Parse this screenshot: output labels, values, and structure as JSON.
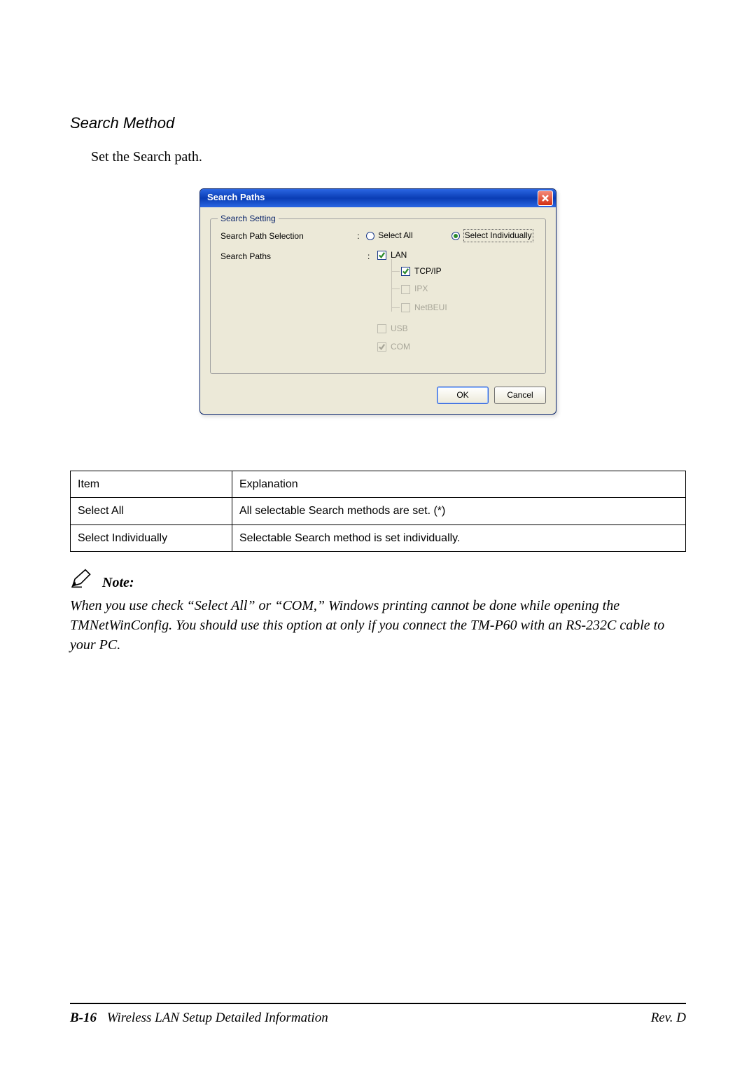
{
  "heading": "Search Method",
  "body_text": "Set the Search path.",
  "dialog": {
    "title": "Search Paths",
    "group_legend": "Search Setting",
    "row_selection_label": "Search Path Selection",
    "row_paths_label": "Search Paths",
    "radio_select_all": "Select All",
    "radio_select_individually": "Select Individually",
    "tree": {
      "lan": "LAN",
      "tcpip": "TCP/IP",
      "ipx": "IPX",
      "netbeui": "NetBEUI",
      "usb": "USB",
      "com": "COM"
    },
    "ok": "OK",
    "cancel": "Cancel"
  },
  "table": {
    "head_item": "Item",
    "head_explanation": "Explanation",
    "rows": [
      {
        "item": "Select All",
        "explanation": "All selectable Search methods are set. (*)"
      },
      {
        "item": "Select Individually",
        "explanation": "Selectable Search method is set individually."
      }
    ]
  },
  "note": {
    "label": "Note:",
    "text": "When you use check “Select All” or “COM,”  Windows printing cannot be done while opening the TMNetWinConfig. You should use this option at only if you connect the TM-P60 with an RS-232C cable to your PC."
  },
  "footer": {
    "pageno": "B-16",
    "left": "Wireless LAN Setup Detailed Information",
    "right": "Rev. D"
  },
  "chart_data": {
    "type": "table",
    "columns": [
      "Item",
      "Explanation"
    ],
    "rows": [
      [
        "Select All",
        "All selectable Search methods are set. (*)"
      ],
      [
        "Select Individually",
        "Selectable Search method is set individually."
      ]
    ]
  }
}
